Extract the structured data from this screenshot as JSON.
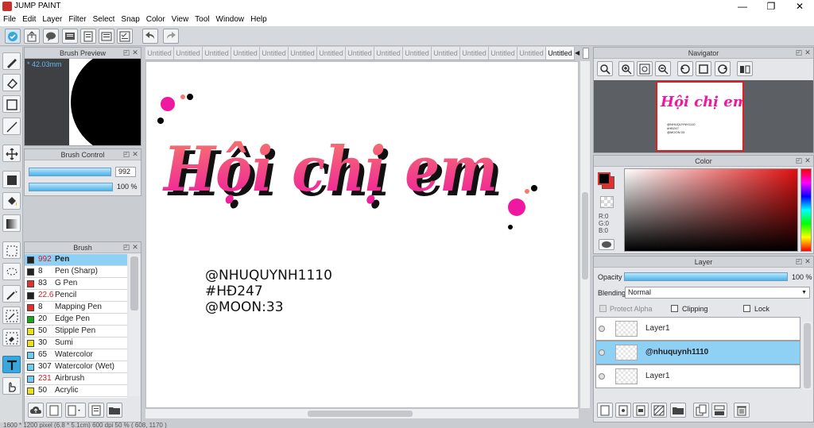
{
  "app": {
    "title": "JUMP PAINT"
  },
  "window_controls": {
    "minimize": "—",
    "maximize": "❐",
    "close": "✕"
  },
  "menu": [
    "File",
    "Edit",
    "Layer",
    "Filter",
    "Select",
    "Snap",
    "Color",
    "View",
    "Tool",
    "Window",
    "Help"
  ],
  "brush_preview": {
    "title": "Brush Preview",
    "size_label": "* 42.03mm"
  },
  "brush_control": {
    "title": "Brush Control",
    "size_value": "992",
    "opacity_value": "100 %"
  },
  "brush_panel": {
    "title": "Brush",
    "items": [
      {
        "size": "992",
        "name": "Pen",
        "swatch": "#222222",
        "size_color": "#d02020",
        "selected": true
      },
      {
        "size": "8",
        "name": "Pen (Sharp)",
        "swatch": "#222222",
        "size_color": "#222222",
        "selected": false
      },
      {
        "size": "83",
        "name": "G Pen",
        "swatch": "#e03030",
        "size_color": "#222222",
        "selected": false
      },
      {
        "size": "22.6",
        "name": "Pencil",
        "swatch": "#222222",
        "size_color": "#d02020",
        "selected": false
      },
      {
        "size": "8",
        "name": "Mapping Pen",
        "swatch": "#e03030",
        "size_color": "#222222",
        "selected": false
      },
      {
        "size": "20",
        "name": "Edge Pen",
        "swatch": "#1aa81a",
        "size_color": "#222222",
        "selected": false
      },
      {
        "size": "50",
        "name": "Stipple Pen",
        "swatch": "#e8e020",
        "size_color": "#222222",
        "selected": false
      },
      {
        "size": "30",
        "name": "Sumi",
        "swatch": "#e8e020",
        "size_color": "#222222",
        "selected": false
      },
      {
        "size": "65",
        "name": "Watercolor",
        "swatch": "#6ccff0",
        "size_color": "#222222",
        "selected": false
      },
      {
        "size": "307",
        "name": "Watercolor (Wet)",
        "swatch": "#6ccff0",
        "size_color": "#222222",
        "selected": false
      },
      {
        "size": "231",
        "name": "Airbrush",
        "swatch": "#6ccff0",
        "size_color": "#d02020",
        "selected": false
      },
      {
        "size": "50",
        "name": "Acrylic",
        "swatch": "#e8e020",
        "size_color": "#222222",
        "selected": false
      }
    ]
  },
  "tabs": [
    "Untitled",
    "Untitled",
    "Untitled",
    "Untitled",
    "Untitled",
    "Untitled",
    "Untitled",
    "Untitled",
    "Untitled",
    "Untitled",
    "Untitled",
    "Untitled",
    "Untitled",
    "Untitled",
    "Untitled"
  ],
  "canvas": {
    "headline": "Hội chị em",
    "credit_lines": [
      "@NHUQUYNH1110",
      "#HĐ247",
      "@MOON:33"
    ]
  },
  "navigator": {
    "title": "Navigator"
  },
  "color_panel": {
    "title": "Color",
    "r_label": "R:0",
    "g_label": "G:0",
    "b_label": "B:0",
    "foreground": "#000000",
    "background": "#e03030"
  },
  "layer_panel": {
    "title": "Layer",
    "opacity_label": "Opacity",
    "opacity_value": "100 %",
    "blending_label": "Blending",
    "blending_value": "Normal",
    "protect_alpha_label": "Protect Alpha",
    "clipping_label": "Clipping",
    "lock_label": "Lock",
    "layers": [
      {
        "name": "Layer1",
        "selected": false
      },
      {
        "name": "@nhuquynh1110",
        "selected": true
      },
      {
        "name": "Layer1",
        "selected": false
      }
    ]
  },
  "status": {
    "text": "1600 * 1200 pixel  (6.8 * 5.1cm)  600 dpi  50 %  ( 608, 1170 )"
  },
  "colors": {
    "accent": "#39a6dc",
    "pink": "#f018a0",
    "salmon": "#f57a6a"
  }
}
